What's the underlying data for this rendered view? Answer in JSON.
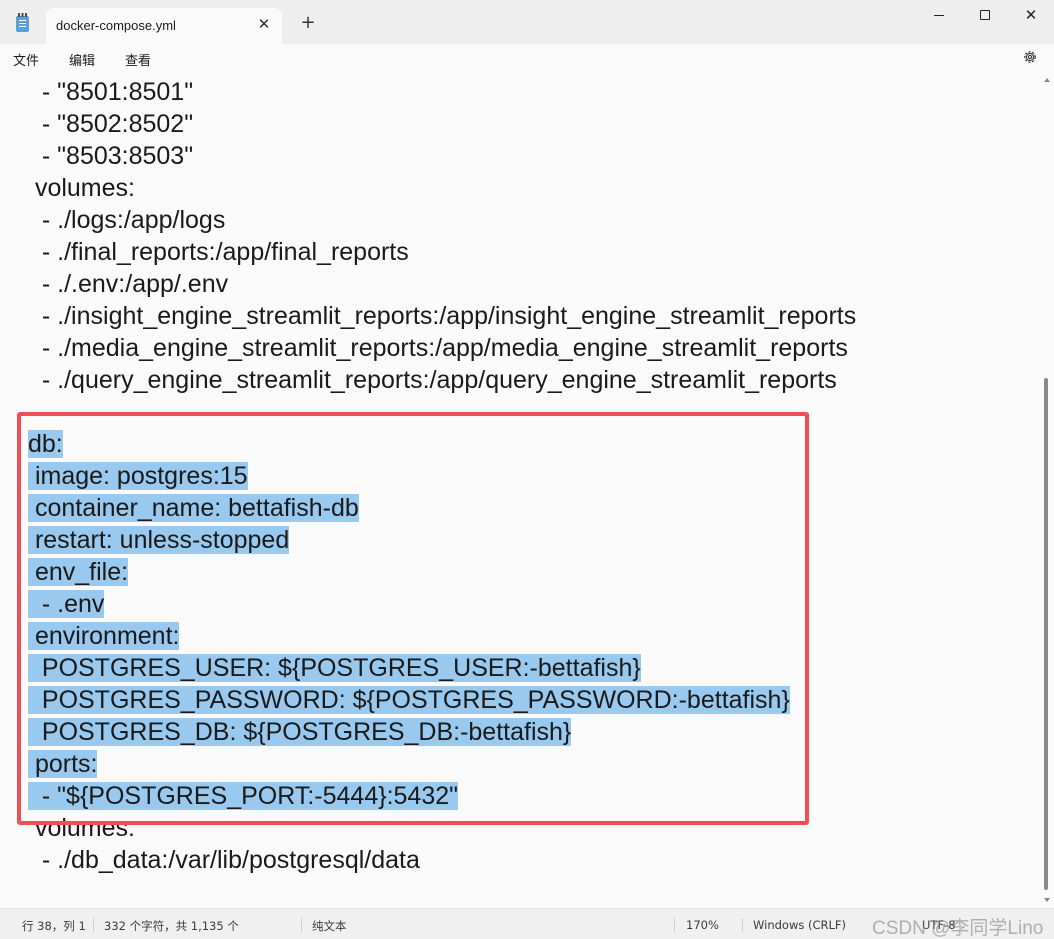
{
  "window": {
    "tab_title": "docker-compose.yml",
    "tab_close_glyph": "✕",
    "new_tab_glyph": "+",
    "close_glyph": "✕"
  },
  "menu": {
    "items": [
      "文件",
      "编辑",
      "查看"
    ]
  },
  "editor": {
    "lines": [
      {
        "text": "  - \"8501:8501\"",
        "selected": false
      },
      {
        "text": "  - \"8502:8502\"",
        "selected": false
      },
      {
        "text": "  - \"8503:8503\"",
        "selected": false
      },
      {
        "text": " volumes:",
        "selected": false
      },
      {
        "text": "  - ./logs:/app/logs",
        "selected": false
      },
      {
        "text": "  - ./final_reports:/app/final_reports",
        "selected": false
      },
      {
        "text": "  - ./.env:/app/.env",
        "selected": false
      },
      {
        "text": "  - ./insight_engine_streamlit_reports:/app/insight_engine_streamlit_reports",
        "selected": false
      },
      {
        "text": "  - ./media_engine_streamlit_reports:/app/media_engine_streamlit_reports",
        "selected": false
      },
      {
        "text": "  - ./query_engine_streamlit_reports:/app/query_engine_streamlit_reports",
        "selected": false
      },
      {
        "text": "",
        "selected": false
      },
      {
        "text": "db:",
        "selected": true
      },
      {
        "text": " image: postgres:15",
        "selected": true
      },
      {
        "text": " container_name: bettafish-db",
        "selected": true
      },
      {
        "text": " restart: unless-stopped",
        "selected": true
      },
      {
        "text": " env_file:",
        "selected": true
      },
      {
        "text": "  - .env",
        "selected": true
      },
      {
        "text": " environment:",
        "selected": true
      },
      {
        "text": "  POSTGRES_USER: ${POSTGRES_USER:-bettafish}",
        "selected": true
      },
      {
        "text": "  POSTGRES_PASSWORD: ${POSTGRES_PASSWORD:-bettafish}",
        "selected": true
      },
      {
        "text": "  POSTGRES_DB: ${POSTGRES_DB:-bettafish}",
        "selected": true
      },
      {
        "text": " ports:",
        "selected": true
      },
      {
        "text": "  - \"${POSTGRES_PORT:-5444}:5432\"",
        "selected": true
      },
      {
        "text": " volumes:",
        "selected": false
      },
      {
        "text": "  - ./db_data:/var/lib/postgresql/data",
        "selected": false
      }
    ]
  },
  "status": {
    "position": "行 38，列 1",
    "chars": "332 个字符，共 1,135 个",
    "format": "纯文本",
    "zoom": "170%",
    "line_ending": "Windows (CRLF)",
    "encoding": "UTF-8",
    "watermark": "CSDN @李同学Lino"
  },
  "colors": {
    "selection": "#99c9ef",
    "highlight_box": "#ee4f54"
  }
}
